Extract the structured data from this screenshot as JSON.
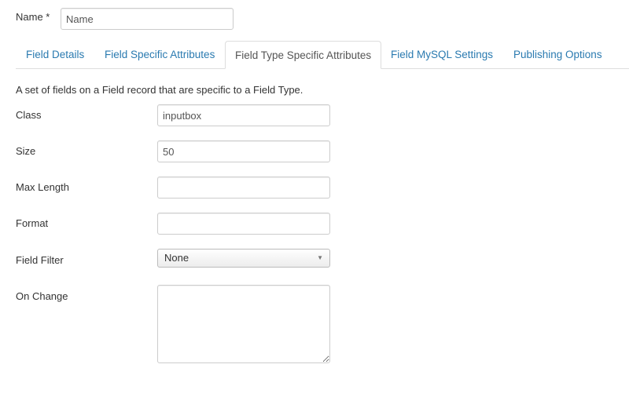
{
  "name_field": {
    "label": "Name *",
    "value": "Name"
  },
  "tabs": [
    {
      "label": "Field Details",
      "active": false
    },
    {
      "label": "Field Specific Attributes",
      "active": false
    },
    {
      "label": "Field Type Specific Attributes",
      "active": true
    },
    {
      "label": "Field MySQL Settings",
      "active": false
    },
    {
      "label": "Publishing Options",
      "active": false
    }
  ],
  "description": "A set of fields on a Field record that are specific to a Field Type.",
  "fields": {
    "class": {
      "label": "Class",
      "value": "inputbox"
    },
    "size": {
      "label": "Size",
      "value": "50"
    },
    "max_length": {
      "label": "Max Length",
      "value": ""
    },
    "format": {
      "label": "Format",
      "value": ""
    },
    "field_filter": {
      "label": "Field Filter",
      "selected": "None"
    },
    "on_change": {
      "label": "On Change",
      "value": ""
    }
  },
  "colors": {
    "link": "#2a7ab0",
    "border": "#dddddd",
    "text": "#333333"
  },
  "icons": {
    "select_arrow": "caret-down-icon"
  }
}
